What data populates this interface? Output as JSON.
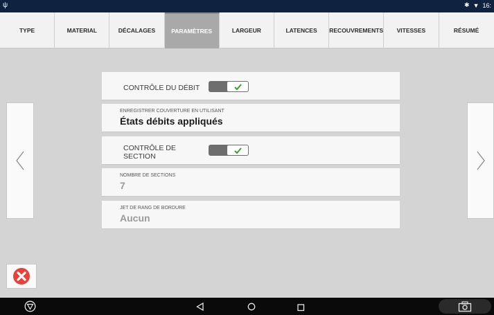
{
  "status_bar": {
    "time": "16:"
  },
  "tabs": [
    {
      "label": "TYPE",
      "active": false
    },
    {
      "label": "MATERIAL",
      "active": false
    },
    {
      "label": "DÉCALAGES",
      "active": false
    },
    {
      "label": "PARAMÈTRES",
      "active": true
    },
    {
      "label": "LARGEUR",
      "active": false
    },
    {
      "label": "LATENCES",
      "active": false
    },
    {
      "label": "RECOUVREMENTS",
      "active": false
    },
    {
      "label": "VITESSES",
      "active": false
    },
    {
      "label": "RÉSUMÉ",
      "active": false
    }
  ],
  "settings": {
    "flow_control": {
      "label": "CONTRÔLE DU DÉBIT",
      "toggle_on": true
    },
    "coverage_record": {
      "label": "ENREGISTRER COUVERTURE EN UTILISANT",
      "value": "États débits appliqués"
    },
    "section_control": {
      "label_line1": "CONTRÔLE DE",
      "label_line2": "SECTION",
      "toggle_on": true
    },
    "section_count": {
      "label": "NOMBRE DE SECTIONS",
      "value": "7"
    },
    "border_row_jet": {
      "label": "JET DE RANG DE BORDURE",
      "value": "Aucun"
    }
  },
  "colors": {
    "status_bar": "#0f2240",
    "active_tab": "#a9a9a9",
    "toggle_check": "#3aa02a",
    "close_red": "#e8403a",
    "disabled_value": "#9a9a9a"
  },
  "icons": {
    "prev": "chevron-left-icon",
    "next": "chevron-right-icon",
    "close": "close-circle-icon",
    "back": "back-triangle-icon",
    "home": "home-circle-icon",
    "recents": "recents-square-icon",
    "screenshot": "camera-icon"
  }
}
